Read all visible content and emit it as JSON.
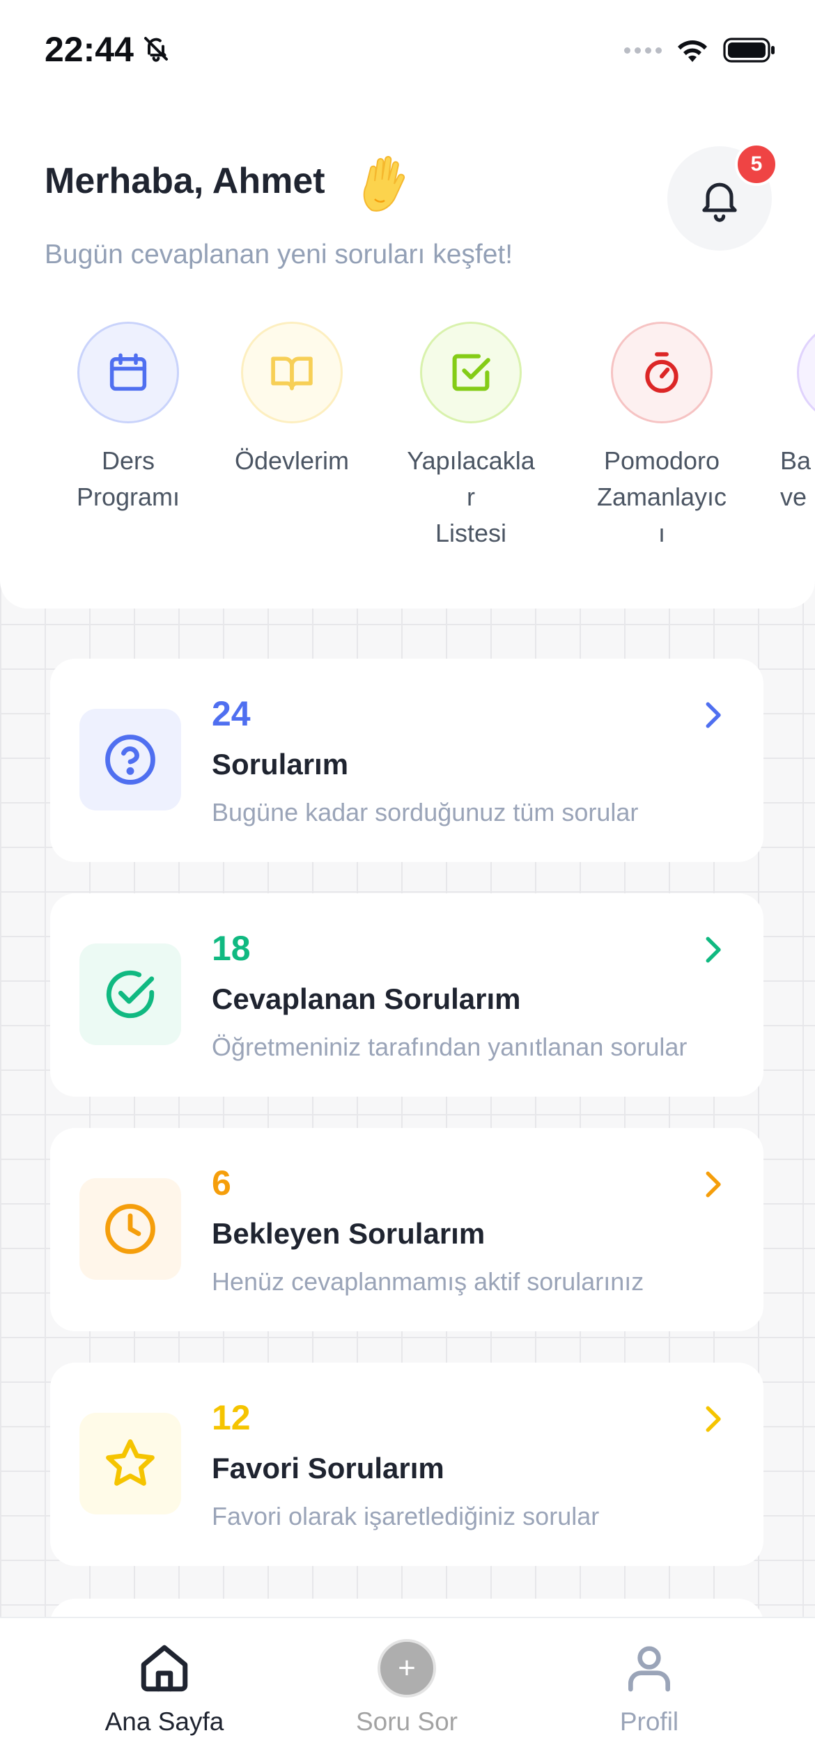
{
  "status_bar": {
    "time": "22:44",
    "silent_icon": "bell-slash-icon",
    "signal_icon": "signal-dots-icon",
    "wifi_icon": "wifi-icon",
    "battery_icon": "battery-icon"
  },
  "header": {
    "greeting": "Merhaba, Ahmet",
    "wave_icon": "waving-hand-icon",
    "subtitle": "Bugün cevaplanan yeni soruları keşfet!",
    "notifications": {
      "icon": "bell-icon",
      "badge": "5",
      "badge_color": "#ef4444"
    }
  },
  "quick_actions": [
    {
      "label": "Ders\nProgramı",
      "icon": "calendar-icon",
      "color": "#4f6ff0",
      "bg": "#eef1fe",
      "border": "#c9d3fb"
    },
    {
      "label": "Ödevlerim",
      "icon": "book-open-icon",
      "color": "#f7cf56",
      "bg": "#fffbeb",
      "border": "#fdefc0"
    },
    {
      "label": "Yapılacakla\nr\nListesi",
      "icon": "check-square-icon",
      "color": "#84cc16",
      "bg": "#f5fce8",
      "border": "#d9f2ad"
    },
    {
      "label": "Pomodoro\nZamanlayıc\nı",
      "icon": "timer-icon",
      "color": "#dc2626",
      "bg": "#fdf0f0",
      "border": "#f6c3c3"
    },
    {
      "label": "Ba\nve",
      "icon": "partial-icon",
      "color": "#8b5cf6",
      "bg": "#f6f2ff",
      "border": "#e0d3fd"
    }
  ],
  "stats": [
    {
      "count": "24",
      "title": "Sorularım",
      "desc": "Bugüne kadar sorduğunuz tüm sorular",
      "icon": "question-circle-icon",
      "color": "#4f6ff0",
      "bg": "#eef1fe"
    },
    {
      "count": "18",
      "title": "Cevaplanan Sorularım",
      "desc": "Öğretmeniniz tarafından yanıtlanan sorular",
      "icon": "check-circle-icon",
      "color": "#10b981",
      "bg": "#ecfaf4"
    },
    {
      "count": "6",
      "title": "Bekleyen Sorularım",
      "desc": "Henüz cevaplanmamış aktif sorularınız",
      "icon": "clock-icon",
      "color": "#f59e0b",
      "bg": "#fff6ea"
    },
    {
      "count": "12",
      "title": "Favori Sorularım",
      "desc": "Favori olarak işaretlediğiniz sorular",
      "icon": "star-icon",
      "color": "#f5c400",
      "bg": "#fffbe8"
    }
  ],
  "tab_bar": {
    "tabs": [
      {
        "label": "Ana Sayfa",
        "icon": "home-icon",
        "active": true,
        "color": "#1f2430"
      },
      {
        "label": "Soru Sor",
        "icon": "plus-icon",
        "active": false,
        "color": "#a3a3a3"
      },
      {
        "label": "Profil",
        "icon": "user-icon",
        "active": false,
        "color": "#9aa4b8"
      }
    ]
  }
}
